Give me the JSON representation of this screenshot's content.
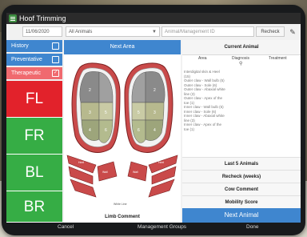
{
  "window": {
    "title": "Hoof Trimming"
  },
  "toolbar": {
    "date": "11/06/2020",
    "animals_select": "All Animals",
    "search_placeholder": "Animal/Management ID",
    "recheck_label": "Recheck"
  },
  "tabs": {
    "history": "History",
    "preventative": "Preventative",
    "therapeutic": "Therapeutic"
  },
  "hooves": [
    "FL",
    "FR",
    "BL",
    "BR"
  ],
  "center": {
    "next_area": "Next Area",
    "limb_comment": "Limb Comment",
    "zones": {
      "left_outer": [
        "2",
        "3",
        "4"
      ],
      "left_inner": [
        "5",
        "6"
      ],
      "right_inner": [
        "5",
        "6"
      ],
      "right_outer": [
        "2",
        "3",
        "4"
      ],
      "heel_left": "Heel",
      "heel_right": "Heel",
      "wall_labels": [
        "Wall",
        "Wall"
      ],
      "white_line": "White Line"
    }
  },
  "current_animal": {
    "title": "Current Animal",
    "columns": [
      "Area",
      "Diagnosis",
      "Treatment"
    ],
    "history": [
      "Interdigital skin & Heel",
      "(15)",
      "Outer claw - Wall bulb (5)",
      "Outer claw - Sole (6)",
      "Outer claw - Abaxial white",
      "line (3)",
      "Outer claw - Apex of the",
      "toe (1)",
      "Inner claw - Wall bulb (5)",
      "Inner claw - Sole (6)",
      "Inner claw - Abaxial white",
      "line (3)",
      "Inner claw - Apex of the",
      "toe (1)"
    ]
  },
  "actions": {
    "last5": "Last 5 Animals",
    "recheck": "Recheck (weeks)",
    "cow_comment": "Cow Comment",
    "mobility": "Mobility Score",
    "next_animal": "Next Animal"
  },
  "bottom": {
    "cancel": "Cancel",
    "management_groups": "Management Groups",
    "done": "Done"
  },
  "colors": {
    "accent_blue": "#3f86cf",
    "alert_red": "#e2222b",
    "ok_green": "#36ad45",
    "therapeutic_pink": "#f06a6f"
  }
}
